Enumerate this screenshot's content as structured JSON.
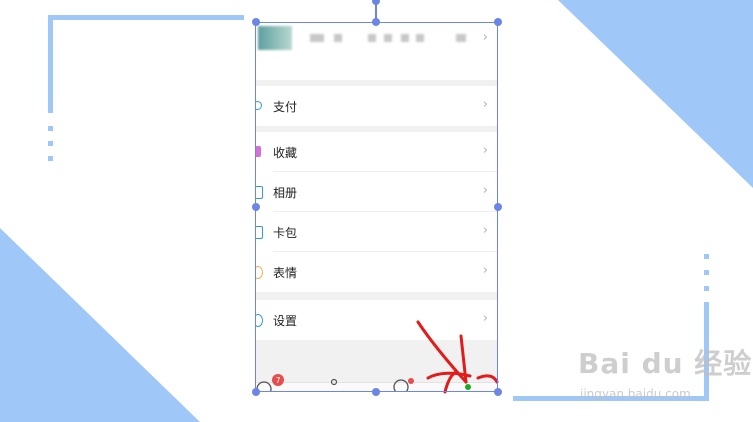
{
  "menu": {
    "items": [
      {
        "label": "支付",
        "icon": "payment-icon"
      },
      {
        "label": "收藏",
        "icon": "favorites-icon"
      },
      {
        "label": "相册",
        "icon": "album-icon"
      },
      {
        "label": "卡包",
        "icon": "card-icon"
      },
      {
        "label": "表情",
        "icon": "sticker-icon"
      },
      {
        "label": "设置",
        "icon": "settings-icon"
      }
    ],
    "chevron": "›"
  },
  "tabbar": {
    "badge_count": "7"
  },
  "watermark": {
    "brand": "Bai du 经验",
    "url": "jingyan.baidu.com"
  },
  "colors": {
    "accent": "#9fc8f8",
    "selection": "#6b86e6",
    "annotation": "#e21b1b"
  }
}
